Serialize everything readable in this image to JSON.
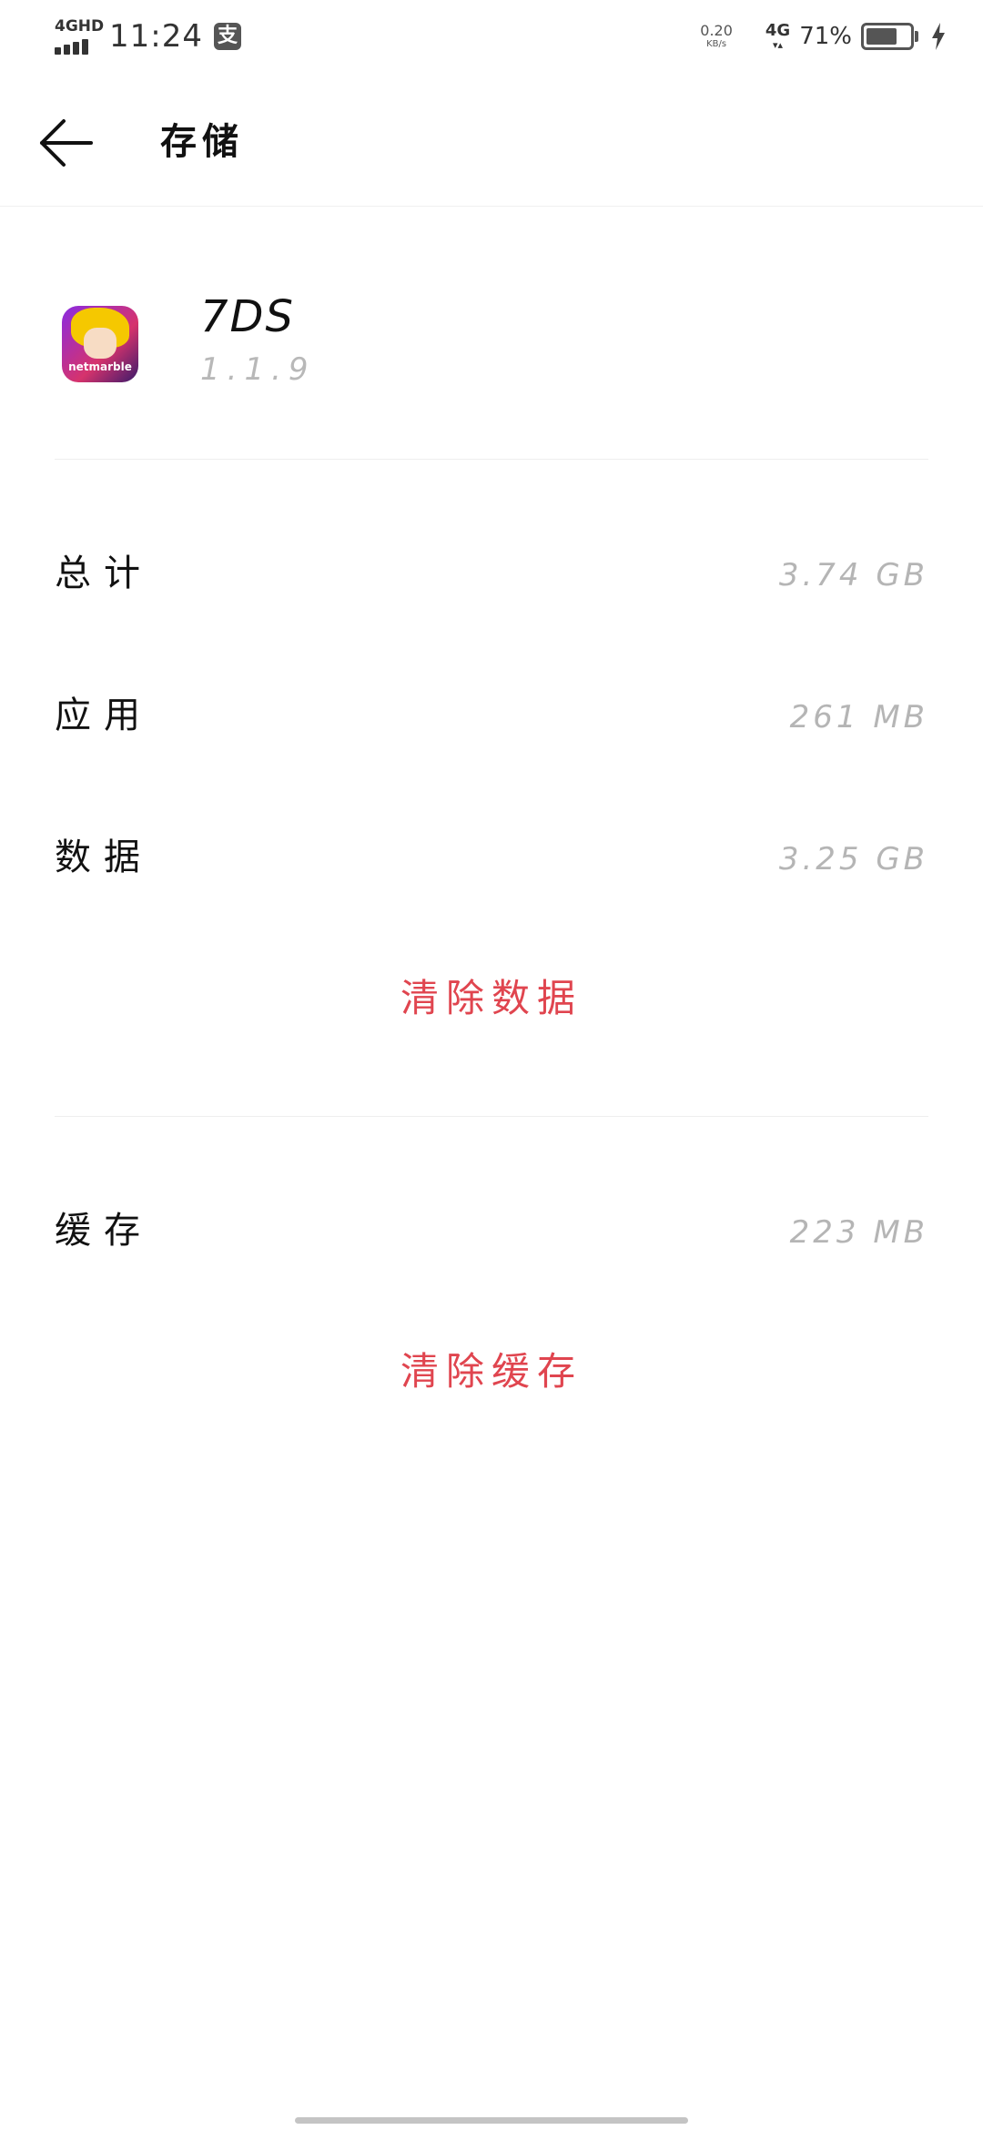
{
  "status_bar": {
    "network_type": "4GHD",
    "time": "11:24",
    "alipay_icon_text": "支",
    "net_speed_value": "0.20",
    "net_speed_unit": "KB/s",
    "data_type": "4G",
    "data_arrows": "▾▴",
    "battery_text": "71%",
    "battery_level": 0.71,
    "icons": [
      "signal-icon",
      "alipay-icon",
      "data-activity-icon",
      "battery-icon",
      "charging-icon"
    ]
  },
  "header": {
    "title": "存储",
    "back_icon": "arrow-left-icon"
  },
  "app": {
    "name": "7DS",
    "version": "1.1.9",
    "icon_brand_text": "netmarble"
  },
  "storage": {
    "total_label": "总计",
    "total_value": "3.74 GB",
    "app_label": "应用",
    "app_value": "261 MB",
    "data_label": "数据",
    "data_value": "3.25 GB",
    "clear_data_label": "清除数据",
    "cache_label": "缓存",
    "cache_value": "223 MB",
    "clear_cache_label": "清除缓存"
  },
  "colors": {
    "accent_red": "#e0454f",
    "value_gray": "#b5b5b5",
    "text_dark": "#111111"
  }
}
